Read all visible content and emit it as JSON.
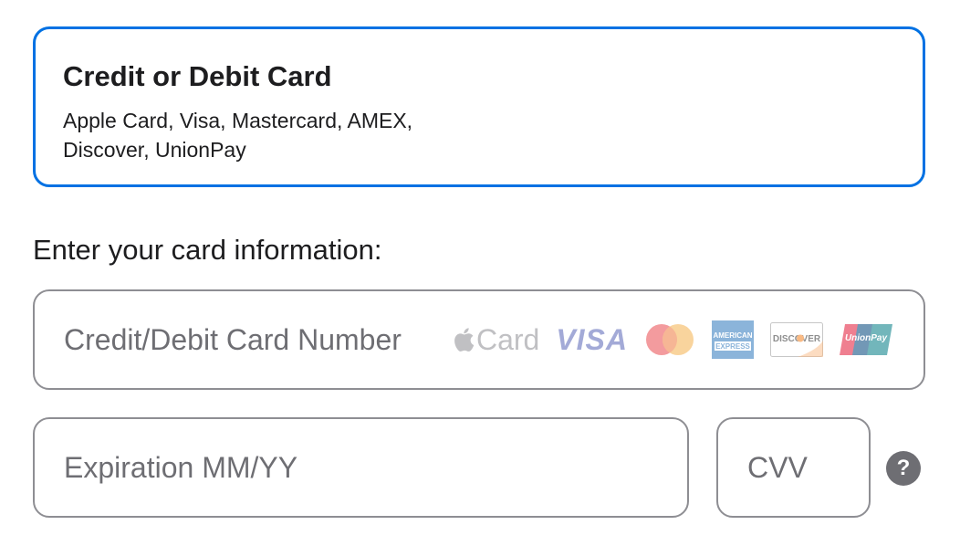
{
  "payment_option": {
    "title": "Credit or Debit Card",
    "description": "Apple Card, Visa, Mastercard, AMEX, Discover, UnionPay",
    "selected": true,
    "accent_color": "#0071e3"
  },
  "section_label": "Enter your card information:",
  "fields": {
    "card_number": {
      "placeholder": "Credit/Debit Card Number",
      "value": ""
    },
    "expiration": {
      "placeholder": "Expiration MM/YY",
      "value": ""
    },
    "cvv": {
      "placeholder": "CVV",
      "value": ""
    }
  },
  "card_logos": {
    "apple_card": "Card",
    "visa": "VISA",
    "mastercard": "mastercard-icon",
    "amex_line1": "AMERICAN",
    "amex_line2": "EXPRESS",
    "discover": "DISCOVER",
    "unionpay": "UnionPay"
  },
  "help_icon": "?"
}
